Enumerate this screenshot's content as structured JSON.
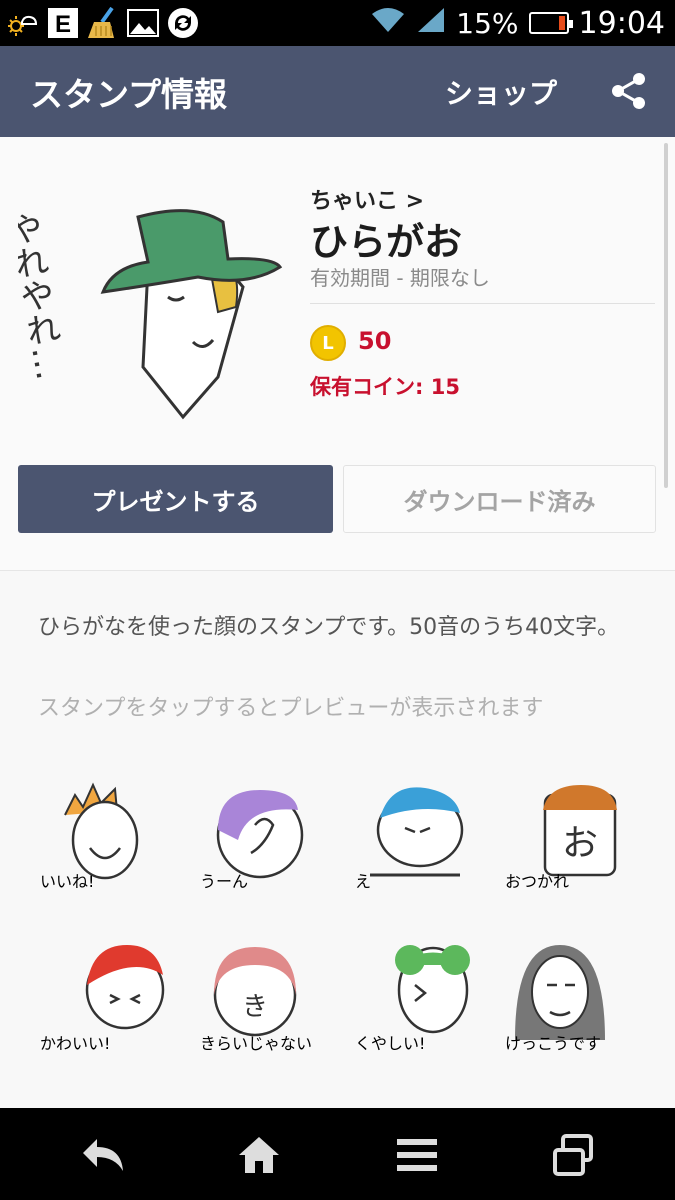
{
  "status_bar": {
    "icons": [
      "weather-icon",
      "e-app-icon",
      "cleaner-icon",
      "gallery-icon",
      "sync-icon",
      "wifi-icon",
      "signal-icon",
      "battery-icon"
    ],
    "battery_percent": "15%",
    "battery_level": 0.15,
    "time": "19:04"
  },
  "header": {
    "title": "スタンプ情報",
    "shop_label": "ショップ",
    "share_icon": "share-icon"
  },
  "product": {
    "author": "ちゃいこ >",
    "name": "ひらがお",
    "validity": "有効期間 - 期限なし",
    "coin_letter": "L",
    "price": "50",
    "owned_coins": "保有コイン: 15",
    "present_label": "プレゼントする",
    "download_label": "ダウンロード済み",
    "main_sticker_text": "やれやれ…"
  },
  "description": {
    "text": "ひらがなを使った顔のスタンプです。50音のうち40文字。",
    "tap_hint": "スタンプをタップするとプレビューが表示されます"
  },
  "stickers": [
    {
      "text": "いいね!",
      "color": "#f0a640"
    },
    {
      "text": "うーん",
      "color": "#a985d8"
    },
    {
      "text": "え",
      "color": "#3aa0d8"
    },
    {
      "text": "おつかれ",
      "color": "#d0782c"
    },
    {
      "text": "かわいい!",
      "color": "#e03a2e"
    },
    {
      "text": "きらいじゃない",
      "color": "#e08a8a"
    },
    {
      "text": "くやしい!",
      "color": "#5cb85c"
    },
    {
      "text": "けっこうです",
      "color": "#777777"
    }
  ],
  "nav": {
    "back": "back-icon",
    "home": "home-icon",
    "menu": "menu-icon",
    "recent": "recent-apps-icon"
  },
  "colors": {
    "header_bg": "#4b5570",
    "price_red": "#c8102e",
    "coin_gold": "#f2c400"
  }
}
